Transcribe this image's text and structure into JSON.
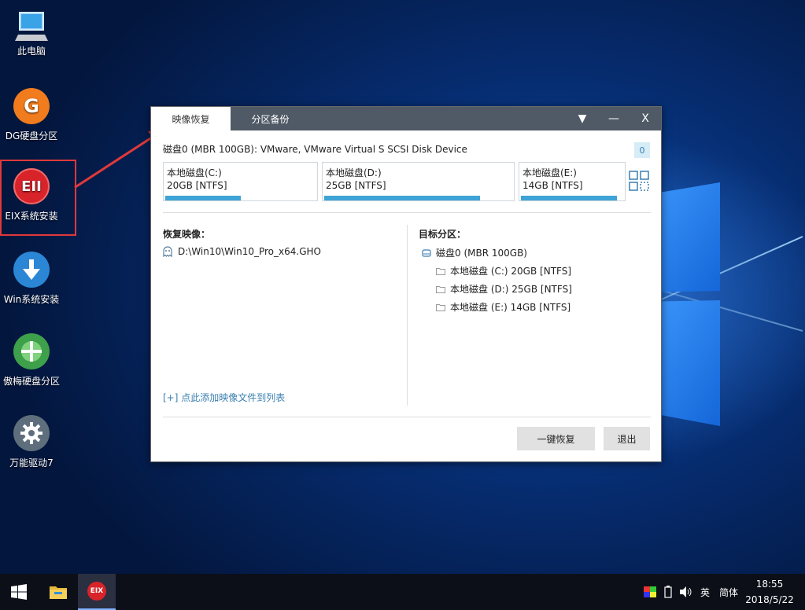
{
  "desktop": {
    "icons": [
      {
        "label": "此电脑",
        "icon": "computer-icon"
      },
      {
        "label": "DG硬盘分区",
        "icon": "dg-icon",
        "color": "#f07c1e",
        "glyph": "G"
      },
      {
        "label": "EIX系统安装",
        "icon": "eix-icon",
        "color": "#d8232a",
        "glyph": "EII"
      },
      {
        "label": "Win系统安装",
        "icon": "download-arrow-icon",
        "color": "#2b86d6"
      },
      {
        "label": "傲梅硬盘分区",
        "icon": "aomei-icon",
        "color": "#3ea04a"
      },
      {
        "label": "万能驱动7",
        "icon": "gear-icon",
        "color": "#6a7a8a"
      }
    ]
  },
  "dialog": {
    "tabs": [
      "映像恢复",
      "分区备份"
    ],
    "controls": {
      "dropdown": "▼",
      "minimize": "—",
      "close": "X"
    },
    "disk_header": "磁盘0 (MBR 100GB): VMware, VMware Virtual S SCSI Disk Device",
    "disk_badge": "0",
    "partitions": [
      {
        "name": "本地磁盘(C:)",
        "info": "20GB [NTFS]",
        "fill": 0.5
      },
      {
        "name": "本地磁盘(D:)",
        "info": "25GB [NTFS]",
        "fill": 0.83
      },
      {
        "name": "本地磁盘(E:)",
        "info": "14GB [NTFS]",
        "fill": 0.94
      }
    ],
    "restore_image_title": "恢复映像：",
    "image_path": "D:\\Win10\\Win10_Pro_x64.GHO",
    "target_title": "目标分区：",
    "target_disk": "磁盘0 (MBR 100GB)",
    "target_partitions": [
      "本地磁盘 (C:) 20GB [NTFS]",
      "本地磁盘 (D:) 25GB [NTFS]",
      "本地磁盘 (E:) 14GB [NTFS]"
    ],
    "add_link": "[+] 点此添加映像文件到列表",
    "restore_button": "一键恢复",
    "exit_button": "退出"
  },
  "taskbar": {
    "tray": {
      "ime_lang": "英",
      "ime_mode": "简体"
    },
    "time": "18:55",
    "date": "2018/5/22"
  },
  "colors": {
    "accent": "#3ea3d6",
    "titlebar": "#505a66",
    "highlight_box": "#e0393a"
  }
}
